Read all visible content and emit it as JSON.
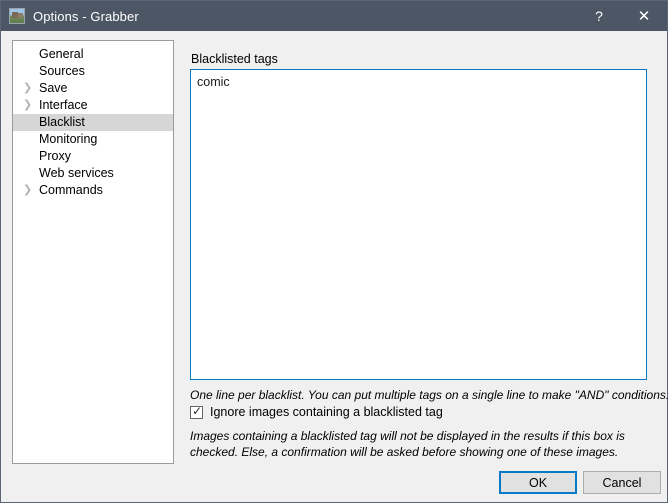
{
  "window": {
    "title": "Options - Grabber",
    "icon": "photo-icon",
    "help_label": "?",
    "close_label": "✕"
  },
  "sidebar": {
    "items": [
      {
        "label": "General",
        "expandable": false,
        "selected": false
      },
      {
        "label": "Sources",
        "expandable": false,
        "selected": false
      },
      {
        "label": "Save",
        "expandable": true,
        "selected": false
      },
      {
        "label": "Interface",
        "expandable": true,
        "selected": false
      },
      {
        "label": "Blacklist",
        "expandable": false,
        "selected": true
      },
      {
        "label": "Monitoring",
        "expandable": false,
        "selected": false
      },
      {
        "label": "Proxy",
        "expandable": false,
        "selected": false
      },
      {
        "label": "Web services",
        "expandable": false,
        "selected": false
      },
      {
        "label": "Commands",
        "expandable": true,
        "selected": false
      }
    ],
    "chevron_glyph": "❯"
  },
  "main": {
    "section_label": "Blacklisted tags",
    "tags_value": "comic",
    "hint_top": "One line per blacklist. You can put multiple tags on a single line to make \"AND\" conditions.",
    "checkbox": {
      "label": "Ignore images containing a blacklisted tag",
      "checked": true,
      "tick_glyph": "✓"
    },
    "hint_bottom": "Images containing a blacklisted tag will not be displayed in the results if this box is checked. Else, a confirmation will be asked before showing one of these images."
  },
  "footer": {
    "ok_label": "OK",
    "cancel_label": "Cancel"
  },
  "colors": {
    "titlebar": "#4c5664",
    "body": "#f0f0f0",
    "accent": "#0a7ac8",
    "selection": "#d6d6d6",
    "button_face": "#e1e1e1"
  }
}
